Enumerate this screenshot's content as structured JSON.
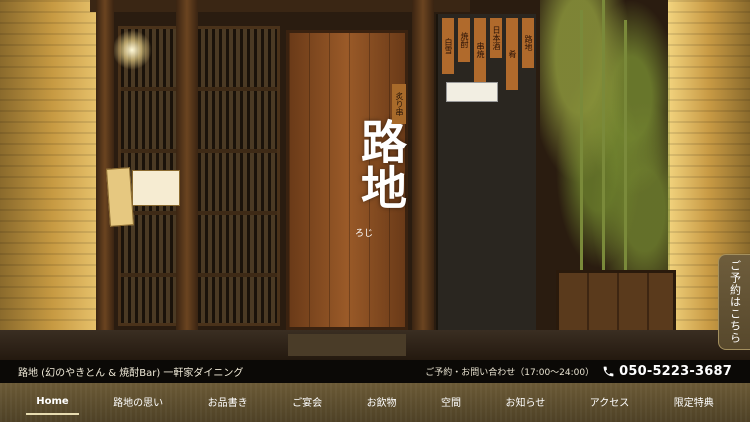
{
  "hero": {
    "brand_name": "路地",
    "brand_reading": "ろじ",
    "door_plate": "炙り串",
    "menu_tags": [
      "白雪",
      "焼酎",
      "串焼",
      "日本酒",
      "肴",
      "路地"
    ]
  },
  "reserve_tab": {
    "label": "ご予約はこちら"
  },
  "infobar": {
    "tagline": "路地 (幻のやきとん & 焼酎Bar) 一軒家ダイニング",
    "contact_label": "ご予約・お問い合わせ（17:00〜24:00）",
    "phone": "050-5223-3687"
  },
  "nav": {
    "items": [
      {
        "label": "Home",
        "active": true
      },
      {
        "label": "路地の思い"
      },
      {
        "label": "お品書き"
      },
      {
        "label": "ご宴会"
      },
      {
        "label": "お飲物"
      },
      {
        "label": "空間"
      },
      {
        "label": "お知らせ"
      },
      {
        "label": "アクセス"
      },
      {
        "label": "限定特典"
      }
    ]
  },
  "colors": {
    "nav_bg": "#5c4d2e",
    "infobar_bg": "#0b0906",
    "reserve_tab_bg": "#6e5d3c",
    "active_underline": "#e8dcb0"
  },
  "icons": {
    "phone": "phone-icon"
  }
}
